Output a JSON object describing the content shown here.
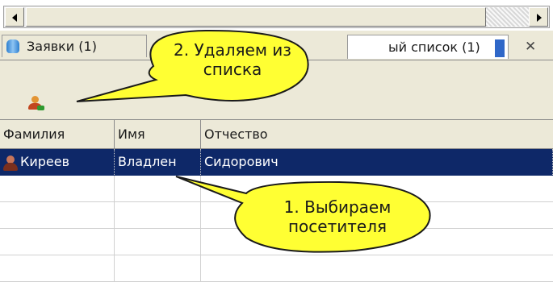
{
  "tabs": [
    {
      "label": "Заявки (1)",
      "icon": "database-icon",
      "active": false
    },
    {
      "label": "ый список (1)",
      "active": true
    }
  ],
  "tab_close_glyph": "✕",
  "toolbar": {
    "button_icon": "person-remove-icon"
  },
  "grid": {
    "columns": [
      "Фамилия",
      "Имя",
      "Отчество"
    ],
    "rows": [
      {
        "surname": "Киреев",
        "name": "Владлен",
        "patronymic": "Сидорович",
        "selected": true
      }
    ]
  },
  "callouts": [
    {
      "lines": [
        "2. Удаляем из",
        "списка"
      ]
    },
    {
      "lines": [
        "1. Выбираем",
        "посетителя"
      ]
    }
  ],
  "colors": {
    "selection": "#0e2868",
    "callout_fill": "#ffff33",
    "chrome": "#ece9d8"
  }
}
